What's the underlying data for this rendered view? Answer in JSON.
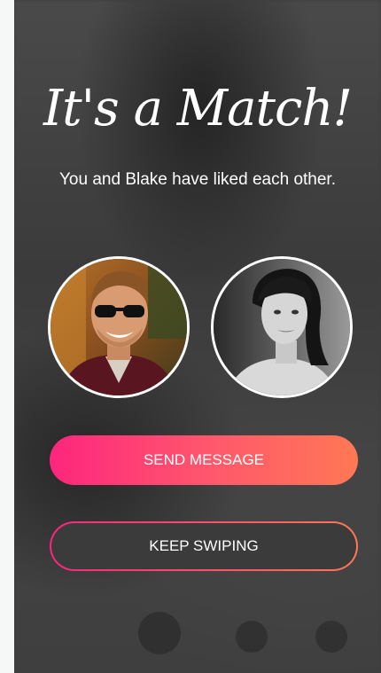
{
  "match": {
    "title": "It's a Match!",
    "subtitle": "You and Blake have liked each other."
  },
  "avatars": {
    "left_alt": "Blake",
    "right_alt": "You"
  },
  "actions": {
    "send_message_label": "SEND MESSAGE",
    "keep_swiping_label": "KEEP SWIPING"
  },
  "colors": {
    "gradient_start": "#fd267d",
    "gradient_end": "#ff7854",
    "overlay": "#3d3d3d",
    "text": "#ffffff"
  }
}
